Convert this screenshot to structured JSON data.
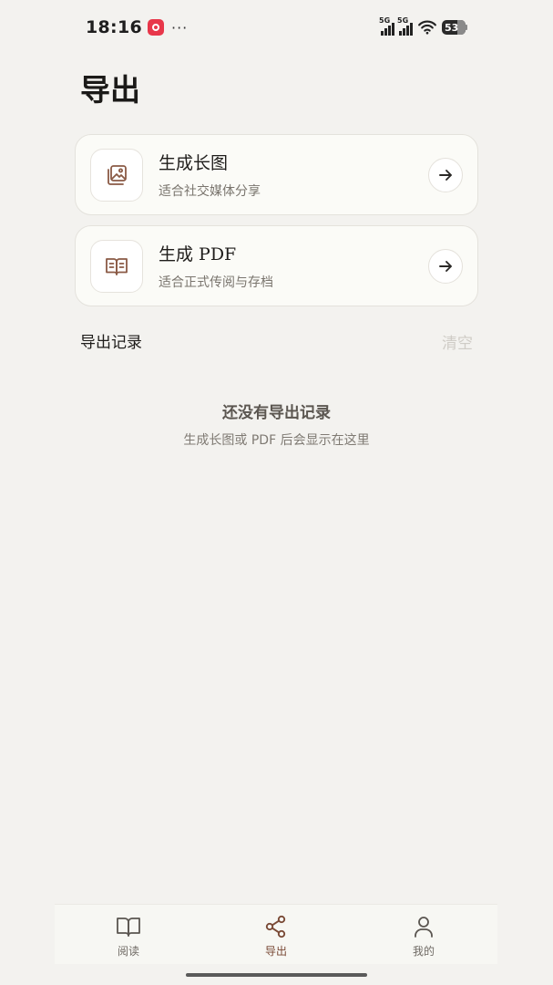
{
  "status_bar": {
    "time": "18:16",
    "more": "···",
    "signal1_label": "5G",
    "signal2_label": "5G",
    "battery": "53"
  },
  "header": {
    "title": "导出"
  },
  "cards": [
    {
      "title": "生成长图",
      "subtitle": "适合社交媒体分享",
      "icon": "image-gallery-icon"
    },
    {
      "title": "生成 PDF",
      "subtitle": "适合正式传阅与存档",
      "icon": "open-book-icon"
    }
  ],
  "records": {
    "section_title": "导出记录",
    "clear_label": "清空",
    "empty_title": "还没有导出记录",
    "empty_subtitle": "生成长图或 PDF 后会显示在这里"
  },
  "tabs": [
    {
      "label": "阅读",
      "icon": "book-icon",
      "active": false
    },
    {
      "label": "导出",
      "icon": "share-icon",
      "active": true
    },
    {
      "label": "我的",
      "icon": "person-icon",
      "active": false
    }
  ],
  "colors": {
    "background": "#f3f2ef",
    "accent": "#7a4a36",
    "icon_brown": "#8a5a45"
  }
}
